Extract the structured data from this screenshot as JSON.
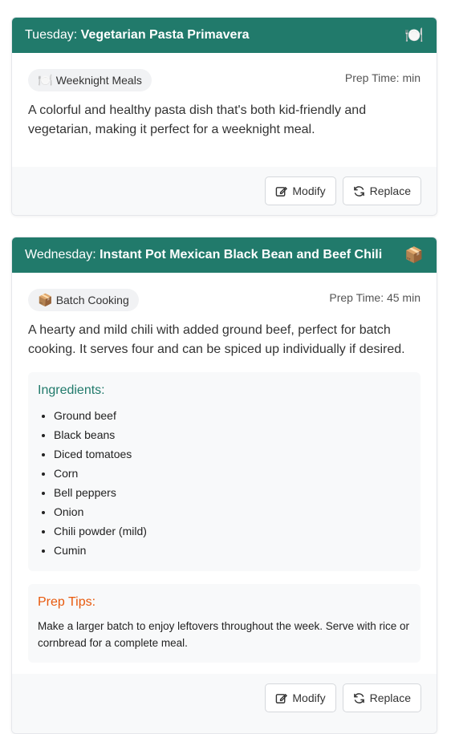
{
  "cards": [
    {
      "day": "Tuesday:",
      "meal": "Vegetarian Pasta Primavera",
      "header_icon": "🍽️",
      "tag_icon": "🍽️",
      "tag": "Weeknight Meals",
      "prep_time": "Prep Time: min",
      "description": "A colorful and healthy pasta dish that's both kid-friendly and vegetarian, making it perfect for a weeknight meal.",
      "modify_label": "Modify",
      "replace_label": "Replace"
    },
    {
      "day": "Wednesday:",
      "meal": "Instant Pot Mexican Black Bean and Beef Chili",
      "header_icon": "📦",
      "tag_icon": "📦",
      "tag": "Batch Cooking",
      "prep_time": "Prep Time: 45 min",
      "description": "A hearty and mild chili with added ground beef, perfect for batch cooking. It serves four and can be spiced up individually if desired.",
      "ingredients_title": "Ingredients:",
      "ingredients": [
        "Ground beef",
        "Black beans",
        "Diced tomatoes",
        "Corn",
        "Bell peppers",
        "Onion",
        "Chili powder (mild)",
        "Cumin"
      ],
      "tips_title": "Prep Tips:",
      "tips": "Make a larger batch to enjoy leftovers throughout the week. Serve with rice or cornbread for a complete meal.",
      "modify_label": "Modify",
      "replace_label": "Replace"
    }
  ],
  "colors": {
    "header": "#217a6b",
    "ingredients_title": "#217a6b",
    "tips_title": "#e8590c"
  }
}
